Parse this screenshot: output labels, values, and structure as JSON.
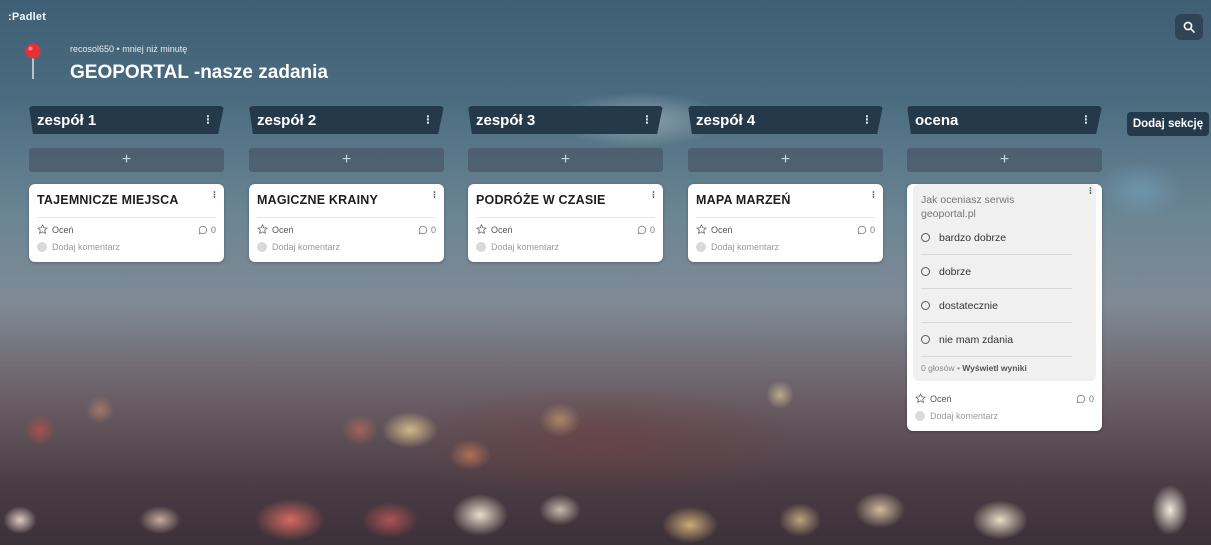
{
  "app": {
    "brand": ":Padlet"
  },
  "header": {
    "author": "recosol650",
    "separator": "•",
    "time": "mniej niż minutę",
    "title": "GEOPORTAL -nasze zadania"
  },
  "search": {
    "icon": "search-icon"
  },
  "sections": [
    {
      "name": "zespół 1",
      "add": "+",
      "card": {
        "title": "TAJEMNICZE MIEJSCA",
        "rate": "Oceń",
        "comments": "0",
        "add_comment": "Dodaj komentarz"
      }
    },
    {
      "name": "zespół 2",
      "add": "+",
      "card": {
        "title": "MAGICZNE KRAINY",
        "rate": "Oceń",
        "comments": "0",
        "add_comment": "Dodaj komentarz"
      }
    },
    {
      "name": "zespół 3",
      "add": "+",
      "card": {
        "title": "PODRÓŻE W CZASIE",
        "rate": "Oceń",
        "comments": "0",
        "add_comment": "Dodaj komentarz"
      }
    },
    {
      "name": "zespół 4",
      "add": "+",
      "card": {
        "title": "MAPA MARZEŃ",
        "rate": "Oceń",
        "comments": "0",
        "add_comment": "Dodaj komentarz"
      }
    },
    {
      "name": "ocena",
      "add": "+",
      "poll": {
        "question": "Jak oceniasz serwis geoportal.pl",
        "options": [
          "bardzo dobrze",
          "dobrze",
          "dostatecznie",
          "nie mam zdania"
        ],
        "votes": "0 głosów",
        "sep": "•",
        "results": "Wyświetl wyniki",
        "rate": "Oceń",
        "comments": "0",
        "add_comment": "Dodaj komentarz"
      }
    }
  ],
  "add_section": "Dodaj sekcję",
  "colors": {
    "section_header": "#24394a",
    "card_bg": "#ffffff",
    "pin": "#e8303a"
  }
}
